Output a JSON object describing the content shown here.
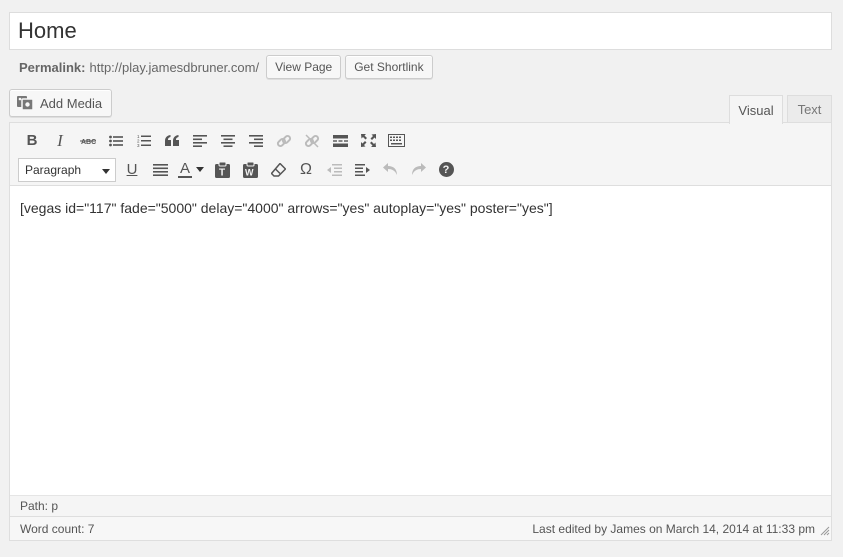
{
  "title_field": {
    "value": "Home"
  },
  "permalink": {
    "label": "Permalink:",
    "url": "http://play.jamesdbruner.com/",
    "view_page_label": "View Page",
    "get_shortlink_label": "Get Shortlink"
  },
  "add_media": {
    "label": "Add Media",
    "icon": "add-media-icon"
  },
  "tabs": {
    "visual": "Visual",
    "text": "Text",
    "active": "Visual"
  },
  "toolbar": {
    "row1": [
      "bold-icon",
      "italic-icon",
      "strikethrough-icon",
      "bullet-list-icon",
      "numbered-list-icon",
      "blockquote-icon",
      "align-left-icon",
      "align-center-icon",
      "align-right-icon",
      "insert-link-icon",
      "unlink-icon",
      "read-more-icon",
      "fullscreen-icon",
      "toolbar-toggle-icon"
    ],
    "format_select": "Paragraph",
    "row2": [
      "underline-icon",
      "justify-icon",
      "text-color-icon",
      "paste-as-text-icon",
      "paste-from-word-icon",
      "clear-formatting-icon",
      "special-character-icon",
      "outdent-icon",
      "indent-icon",
      "undo-icon",
      "redo-icon",
      "help-icon"
    ],
    "glyphs": {
      "bold": "B",
      "italic": "I",
      "underline": "U",
      "text_color": "A",
      "special_character": "Ω",
      "help": "?"
    }
  },
  "editor": {
    "content": "[vegas id=\"117\" fade=\"5000\" delay=\"4000\" arrows=\"yes\" autoplay=\"yes\" poster=\"yes\"]"
  },
  "path": {
    "text": "Path: p"
  },
  "status": {
    "word_count": "Word count: 7",
    "last_edited": "Last edited by James on March 14, 2014 at 11:33 pm"
  }
}
